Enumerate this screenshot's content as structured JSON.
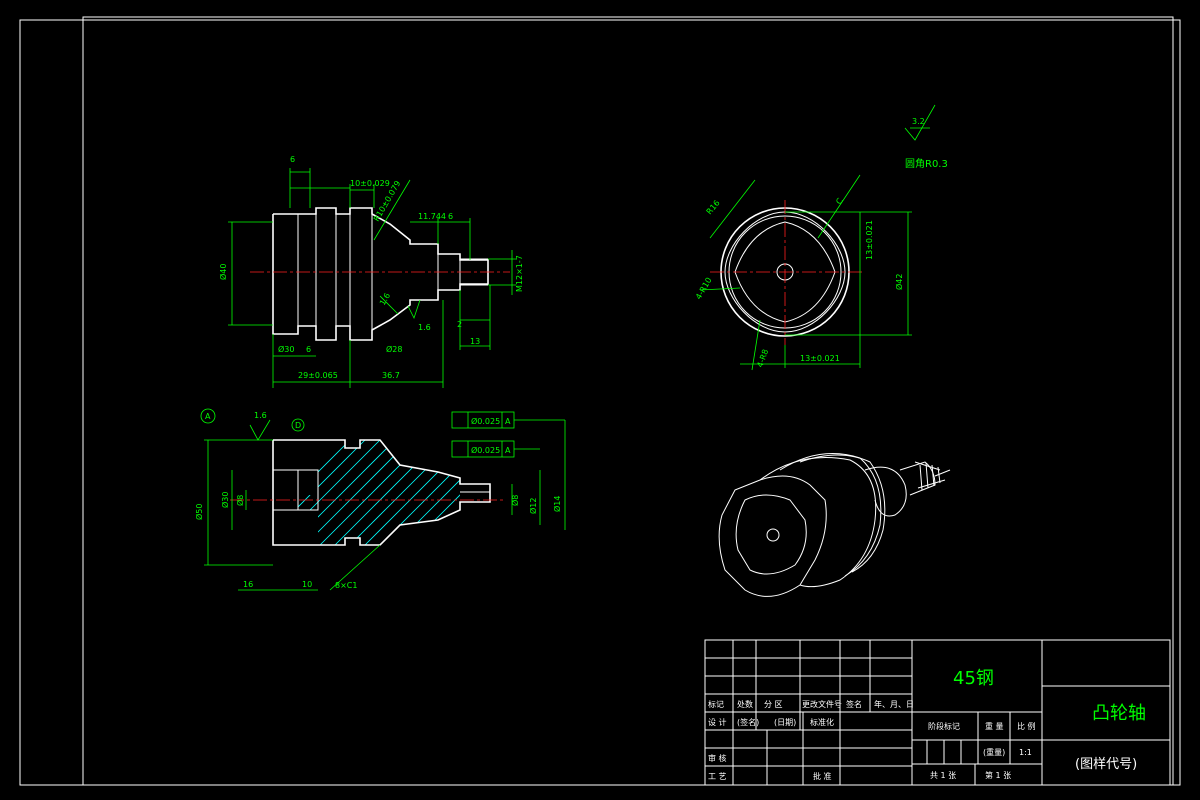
{
  "colors": {
    "background": "#000000",
    "outline": "#ffffff",
    "dimension": "#00ff00",
    "centerline": "#ff2020",
    "hatch": "#00ffff"
  },
  "front_view": {
    "dims": {
      "d1": "Ø40",
      "d2": "R10±0.079",
      "d3": "11.744",
      "d4": "6",
      "d5": "10±0.029",
      "d6": "M12×1-7",
      "d7": "6",
      "d8": "13",
      "d9": "29±0.065",
      "d10": "36.7",
      "d11": "6",
      "d12": "1.6",
      "d13": "2",
      "d14": "Ø30",
      "d15": "Ø28",
      "d16": "1.6"
    }
  },
  "section_view": {
    "label_a": "A",
    "label_d": "D",
    "roughness": "1.6",
    "tol1": {
      "value": "Ø0.025",
      "datum": "A"
    },
    "tol2": {
      "value": "Ø0.025",
      "datum": "A"
    },
    "dims": {
      "d1": "Ø50",
      "d2": "Ø30",
      "d3": "Ø8",
      "d4": "Ø8",
      "d5": "Ø12",
      "d6": "Ø14",
      "d7": "16",
      "d8": "10",
      "d9": "8×C1"
    }
  },
  "end_view": {
    "roughness": "3.2",
    "note": "圆角R0.3",
    "dims": {
      "d1": "13±0.021",
      "d2": "Ø42",
      "d3": "13±0.021",
      "d4": "4-R10",
      "d5": "4-R8",
      "d6": "R16",
      "d7": "C"
    }
  },
  "title_block": {
    "material": "45钢",
    "part_name": "凸轮轴",
    "drawing_code": "(图样代号)",
    "headers": [
      "标记",
      "处数",
      "分 区",
      "更改文件号",
      "签名",
      "年、月、日"
    ],
    "row_design": [
      "设 计",
      "(签名)",
      "(日期)",
      "标准化"
    ],
    "row_review": "审 核",
    "row_process": "工 艺",
    "approve": "批 准",
    "stage_label": "阶段标记",
    "weight_label": "重 量",
    "scale_label": "比 例",
    "weight_value": "(重量)",
    "scale_value": "1:1",
    "sheets_total": "共 1 张",
    "sheet_no": "第 1 张"
  }
}
